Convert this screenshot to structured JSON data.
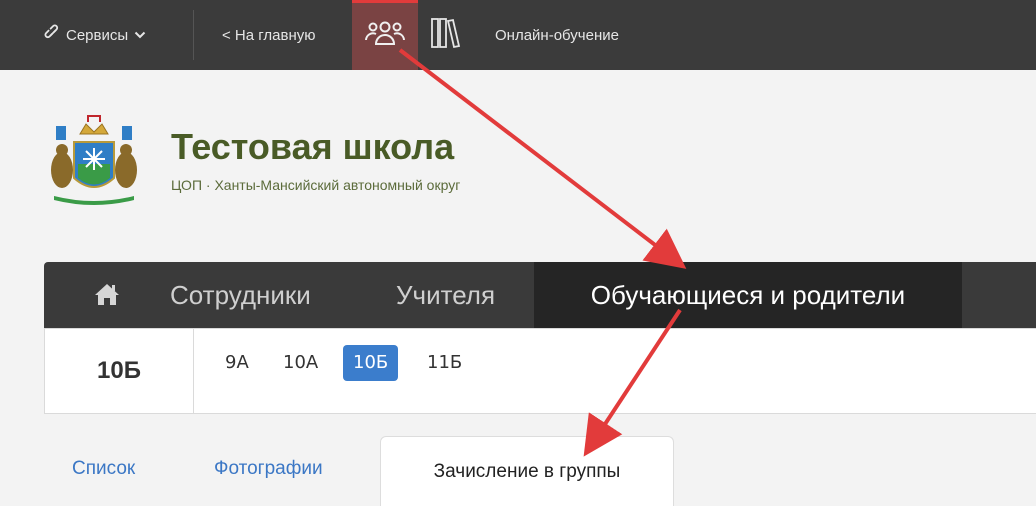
{
  "topbar": {
    "services_label": "Сервисы",
    "home_label": "< На главную",
    "online_label": "Онлайн-обучение"
  },
  "school": {
    "title": "Тестовая школа",
    "subtitle": "ЦОП · Ханты-Мансийский автономный округ"
  },
  "nav": {
    "tabs": [
      {
        "label": "Сотрудники"
      },
      {
        "label": "Учителя"
      },
      {
        "label": "Обучающиеся и родители",
        "active": true
      }
    ]
  },
  "classes": {
    "current": "10Б",
    "list": [
      {
        "label": "9А"
      },
      {
        "label": "10А"
      },
      {
        "label": "10Б",
        "active": true
      },
      {
        "label": "11Б"
      }
    ]
  },
  "subtabs": [
    {
      "label": "Список"
    },
    {
      "label": "Фотографии"
    },
    {
      "label": "Зачисление в группы",
      "active": true
    }
  ],
  "colors": {
    "topbar_bg": "#3b3b3b",
    "nav_bg": "#3a3a3a",
    "active_nav_bg": "#252525",
    "accent_blue": "#3b7dcc",
    "title_green": "#495b26",
    "annotation_red": "#e23b3b"
  },
  "icons": [
    "link-icon",
    "chevron-down-icon",
    "people-icon",
    "library-icon",
    "home-icon",
    "coat-of-arms"
  ]
}
